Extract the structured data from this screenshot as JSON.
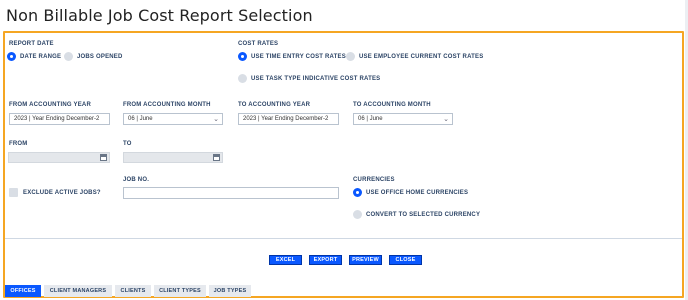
{
  "title": "Non Billable Job Cost Report Selection",
  "report_date": {
    "label": "REPORT DATE",
    "options": [
      "DATE RANGE",
      "JOBS OPENED"
    ],
    "selected": "DATE RANGE"
  },
  "cost_rates": {
    "label": "COST RATES",
    "options": [
      "USE TIME ENTRY COST RATES",
      "USE EMPLOYEE CURRENT COST RATES",
      "USE TASK TYPE INDICATIVE COST RATES"
    ],
    "selected": "USE TIME ENTRY COST RATES"
  },
  "from_accounting_year": {
    "label": "FROM ACCOUNTING YEAR",
    "value": "2023 | Year Ending December-2"
  },
  "from_accounting_month": {
    "label": "FROM ACCOUNTING MONTH",
    "value": "06 | June"
  },
  "to_accounting_year": {
    "label": "TO ACCOUNTING YEAR",
    "value": "2023 | Year Ending December-2"
  },
  "to_accounting_month": {
    "label": "TO ACCOUNTING MONTH",
    "value": "06 | June"
  },
  "from_date": {
    "label": "FROM",
    "value": ""
  },
  "to_date": {
    "label": "TO",
    "value": ""
  },
  "exclude_active_jobs": {
    "label": "EXCLUDE ACTIVE JOBS?",
    "checked": false
  },
  "job_no": {
    "label": "JOB NO.",
    "value": ""
  },
  "currencies": {
    "label": "CURRENCIES",
    "options": [
      "USE OFFICE HOME CURRENCIES",
      "CONVERT TO SELECTED CURRENCY"
    ],
    "selected": "USE OFFICE HOME CURRENCIES"
  },
  "actions": [
    "EXCEL",
    "EXPORT",
    "PREVIEW",
    "CLOSE"
  ],
  "tabs": [
    "OFFICES",
    "CLIENT MANAGERS",
    "CLIENTS",
    "CLIENT TYPES",
    "JOB TYPES"
  ],
  "active_tab": "OFFICES",
  "colors": {
    "accent": "#0a58ff",
    "panel_border": "#f5a623",
    "label": "#2c4466"
  },
  "icons": {
    "select": "chevron-down-icon",
    "date": "calendar-icon"
  }
}
